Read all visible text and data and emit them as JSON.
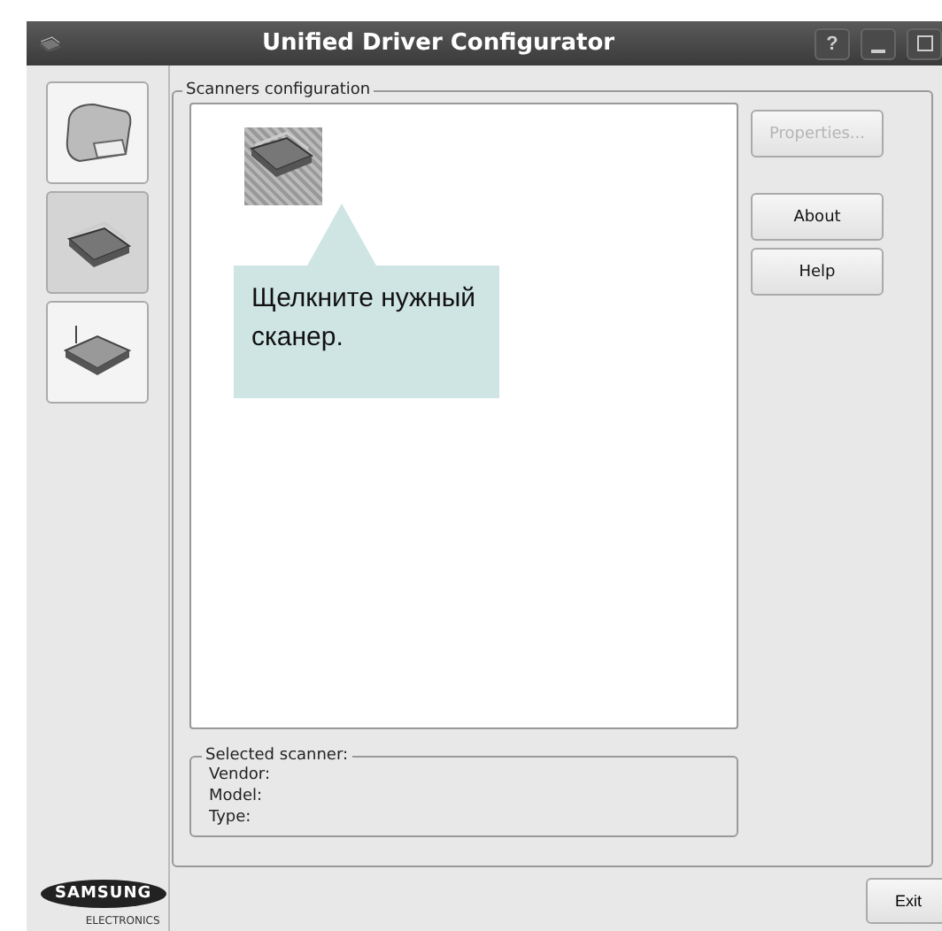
{
  "window": {
    "title": "Unified Driver Configurator",
    "help_button": "?"
  },
  "sidebar": {
    "items": [
      {
        "kind": "printer",
        "selected": false
      },
      {
        "kind": "scanner",
        "selected": true
      },
      {
        "kind": "port",
        "selected": false
      }
    ]
  },
  "scanners": {
    "title": "Scanners configuration",
    "items": [
      {
        "kind": "scanner",
        "selected": true
      }
    ],
    "callout": "Щелкните нужный сканер."
  },
  "buttons": [
    {
      "label": "Properties...",
      "disabled": true
    },
    {
      "label": "About",
      "disabled": false
    },
    {
      "label": "Help",
      "disabled": false
    }
  ],
  "selected_scanner": {
    "title": "Selected scanner:",
    "fields": [
      "Vendor:",
      "Model:",
      "Type:"
    ]
  },
  "logo": {
    "brand": "SAMSUNG",
    "sub": "ELECTRONICS"
  },
  "exit_button": "Exit"
}
